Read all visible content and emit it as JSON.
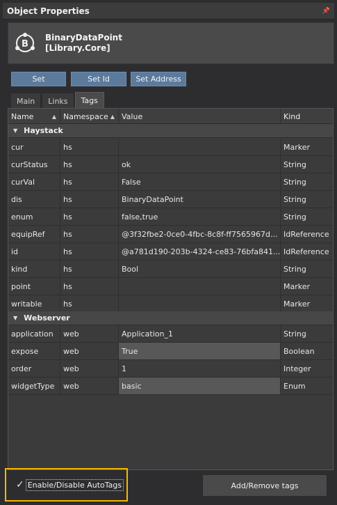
{
  "panel": {
    "title": "Object Properties",
    "pin_icon": "pin-icon"
  },
  "object": {
    "name": "BinaryDataPoint",
    "library": "[Library.Core]",
    "icon": "binary-datapoint-icon"
  },
  "buttons": {
    "set": "Set",
    "set_id": "Set Id",
    "set_address": "Set Address"
  },
  "tabs": [
    {
      "label": "Main"
    },
    {
      "label": "Links"
    },
    {
      "label": "Tags",
      "active": true
    }
  ],
  "grid": {
    "columns": [
      "Name",
      "Namespace",
      "Value",
      "Kind"
    ],
    "groups": [
      {
        "name": "Haystack",
        "rows": [
          {
            "name": "cur",
            "ns": "hs",
            "value": "",
            "kind": "Marker"
          },
          {
            "name": "curStatus",
            "ns": "hs",
            "value": "ok",
            "kind": "String"
          },
          {
            "name": "curVal",
            "ns": "hs",
            "value": "False",
            "kind": "String"
          },
          {
            "name": "dis",
            "ns": "hs",
            "value": "BinaryDataPoint",
            "kind": "String"
          },
          {
            "name": "enum",
            "ns": "hs",
            "value": "false,true",
            "kind": "String"
          },
          {
            "name": "equipRef",
            "ns": "hs",
            "value": "@3f32fbe2-0ce0-4fbc-8c8f-ff7565967d...",
            "kind": "IdReference"
          },
          {
            "name": "id",
            "ns": "hs",
            "value": "@a781d190-203b-4324-ce83-76bfa841...",
            "kind": "IdReference"
          },
          {
            "name": "kind",
            "ns": "hs",
            "value": "Bool",
            "kind": "String"
          },
          {
            "name": "point",
            "ns": "hs",
            "value": "",
            "kind": "Marker"
          },
          {
            "name": "writable",
            "ns": "hs",
            "value": "",
            "kind": "Marker"
          }
        ]
      },
      {
        "name": "Webserver",
        "rows": [
          {
            "name": "application",
            "ns": "web",
            "value": "Application_1",
            "kind": "String"
          },
          {
            "name": "expose",
            "ns": "web",
            "value": "True",
            "kind": "Boolean"
          },
          {
            "name": "order",
            "ns": "web",
            "value": "1",
            "kind": "Integer"
          },
          {
            "name": "widgetType",
            "ns": "web",
            "value": "basic",
            "kind": "Enum"
          }
        ]
      }
    ]
  },
  "footer": {
    "autotags_label": "Enable/Disable AutoTags",
    "autotags_checked": true,
    "add_remove_label": "Add/Remove tags"
  },
  "colors": {
    "highlight_border": "#f5b800",
    "button_blue": "#5b7a9c"
  }
}
